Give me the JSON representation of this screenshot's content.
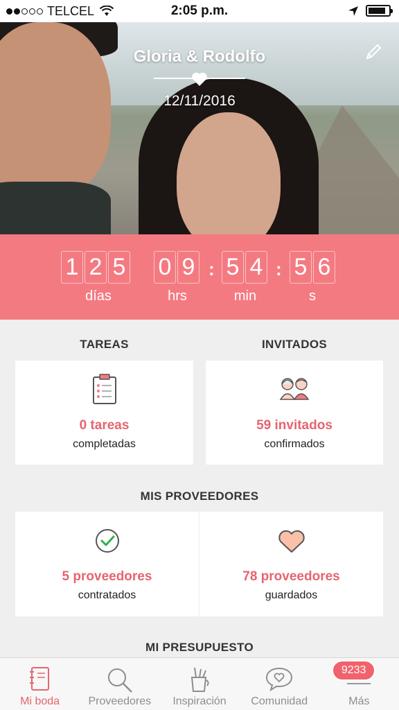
{
  "status_bar": {
    "carrier": "TELCEL",
    "time": "2:05 p.m."
  },
  "hero": {
    "couple_name": "Gloria & Rodolfo",
    "date": "12/11/2016"
  },
  "countdown": {
    "days": [
      "1",
      "2",
      "5"
    ],
    "hours": [
      "0",
      "9"
    ],
    "minutes": [
      "5",
      "4"
    ],
    "seconds": [
      "5",
      "6"
    ],
    "labels": {
      "days": "días",
      "hours": "hrs",
      "minutes": "min",
      "seconds": "s"
    }
  },
  "sections": {
    "tasks": {
      "title": "TAREAS",
      "value": "0 tareas",
      "sub": "completadas"
    },
    "guests": {
      "title": "INVITADOS",
      "value": "59 invitados",
      "sub": "confirmados"
    },
    "vendors_title": "MIS PROVEEDORES",
    "hired": {
      "value": "5 proveedores",
      "sub": "contratados"
    },
    "saved": {
      "value": "78 proveedores",
      "sub": "guardados"
    },
    "budget_title": "MI PRESUPUESTO"
  },
  "tabs": [
    {
      "label": "Mi boda",
      "icon": "notebook-icon",
      "active": true
    },
    {
      "label": "Proveedores",
      "icon": "search-icon"
    },
    {
      "label": "Inspiración",
      "icon": "paint-cup-icon"
    },
    {
      "label": "Comunidad",
      "icon": "chat-heart-icon"
    },
    {
      "label": "Más",
      "icon": "menu-icon",
      "badge": "9233"
    }
  ],
  "colors": {
    "accent": "#f47a82",
    "accent_text": "#e5656e"
  }
}
